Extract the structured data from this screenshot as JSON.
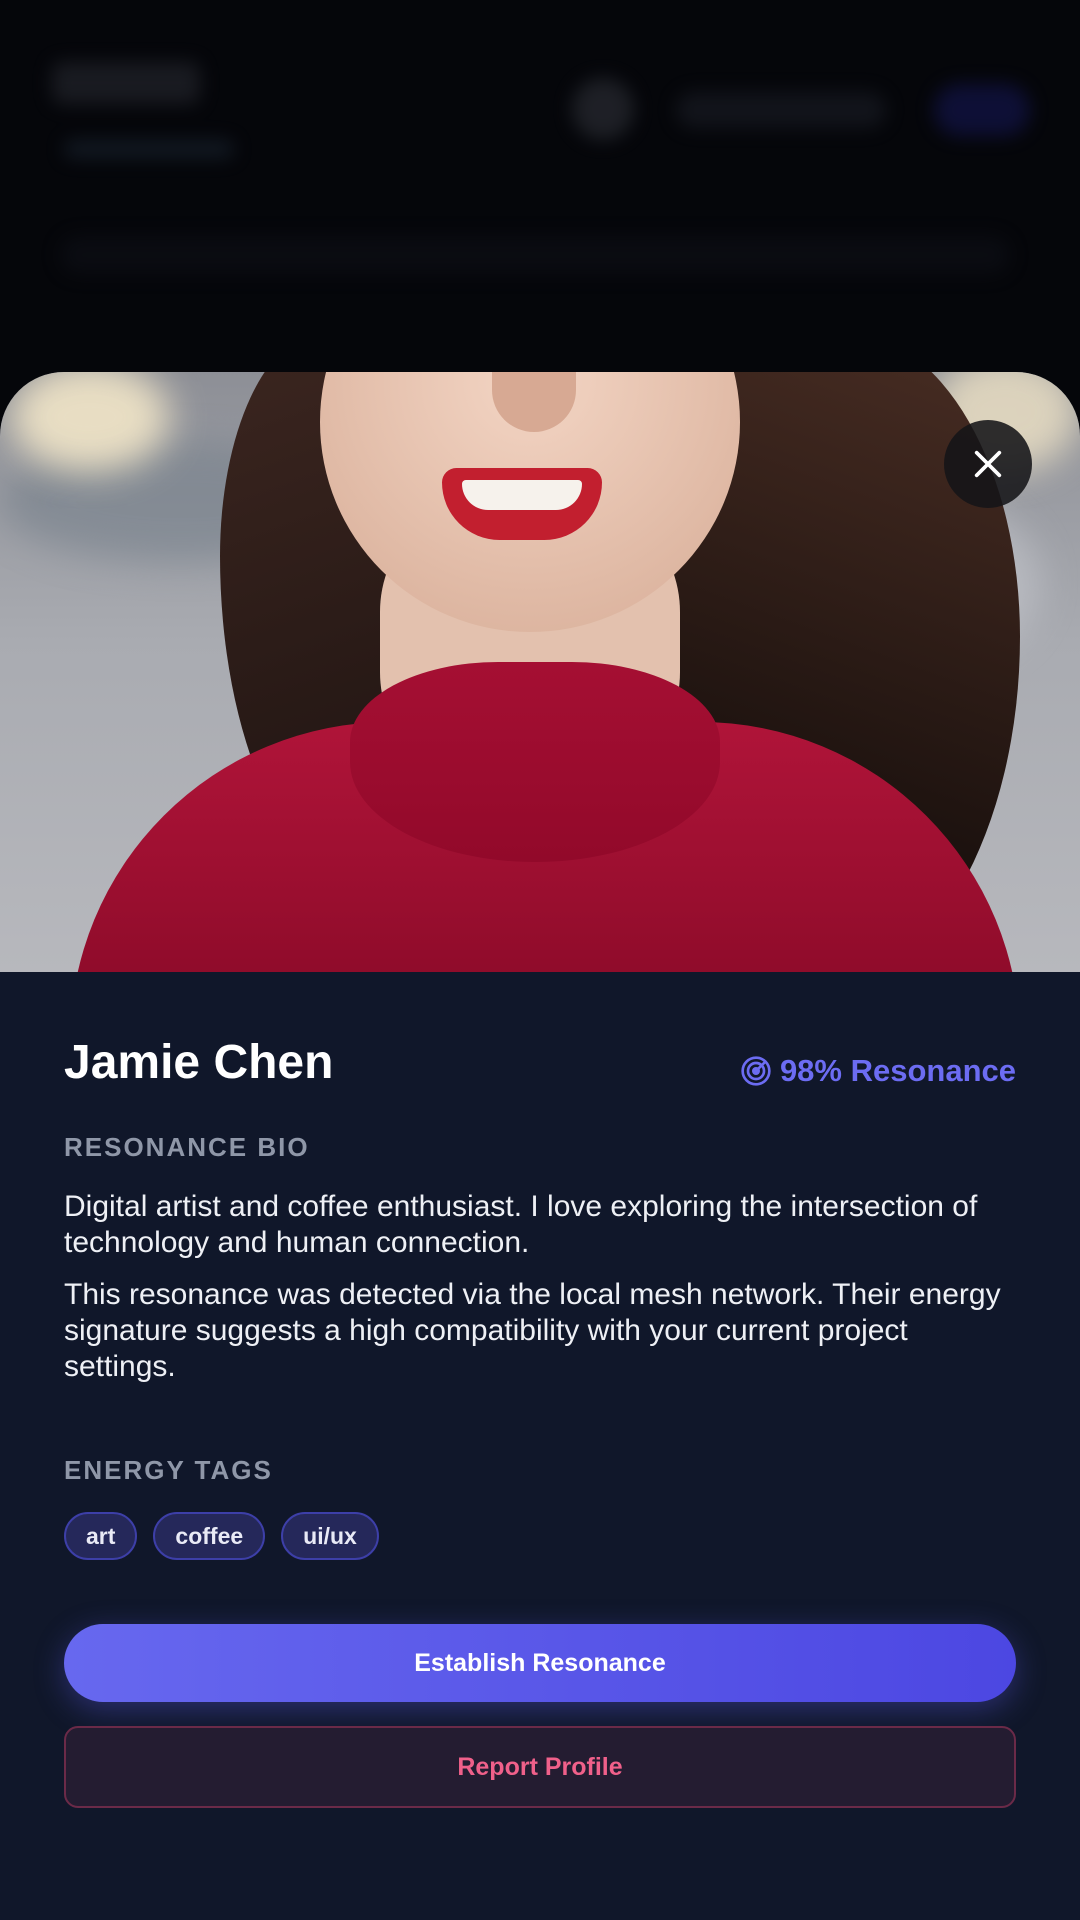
{
  "profile": {
    "name": "Jamie Chen",
    "resonance_label": "98% Resonance",
    "resonance_percent": 98,
    "photo_subject": "smiling woman in red sweater"
  },
  "bio_section": {
    "title": "RESONANCE BIO",
    "paragraphs": [
      "Digital artist and coffee enthusiast. I love exploring the intersection of technology and human connection.",
      "This resonance was detected via the local mesh network. Their energy signature suggests a high compatibility with your current project settings."
    ]
  },
  "tags_section": {
    "title": "ENERGY TAGS",
    "tags": [
      "art",
      "coffee",
      "ui/ux"
    ]
  },
  "actions": {
    "primary_label": "Establish Resonance",
    "report_label": "Report Profile"
  },
  "icons": {
    "close": "close-icon",
    "resonance": "radar-icon"
  },
  "colors": {
    "accent": "#6c6cf2",
    "danger": "#f0608a",
    "sheet_bg": "#10172a"
  }
}
